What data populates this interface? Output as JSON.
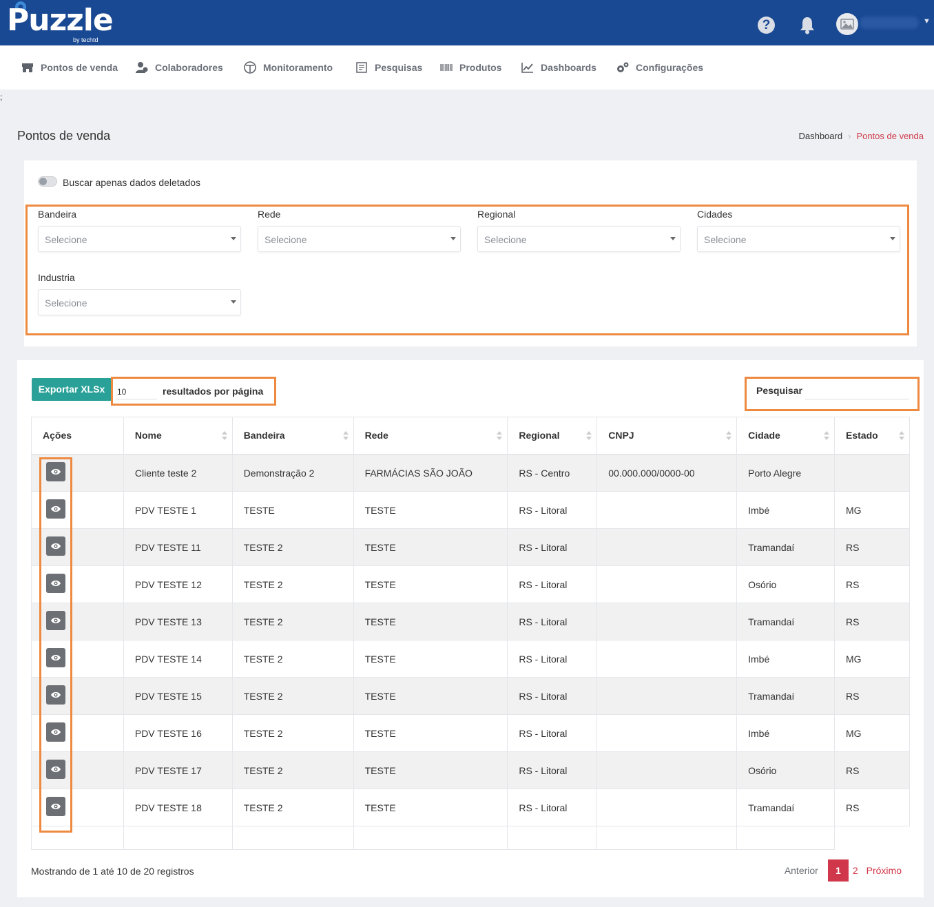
{
  "brand": {
    "name": "Puzzle",
    "sub": "by techtd"
  },
  "header": {
    "help_glyph": "?"
  },
  "nav": [
    {
      "label": "Pontos de venda",
      "icon": "store-icon"
    },
    {
      "label": "Colaboradores",
      "icon": "users-icon"
    },
    {
      "label": "Monitoramento",
      "icon": "monitor-icon"
    },
    {
      "label": "Pesquisas",
      "icon": "survey-icon"
    },
    {
      "label": "Produtos",
      "icon": "barcode-icon"
    },
    {
      "label": "Dashboards",
      "icon": "chart-icon"
    },
    {
      "label": "Configurações",
      "icon": "gears-icon"
    }
  ],
  "stray_text": ";",
  "page": {
    "title": "Pontos de venda",
    "breadcrumb": {
      "home": "Dashboard",
      "separator": "›",
      "current": "Pontos de venda"
    }
  },
  "filters": {
    "toggle_label": "Buscar apenas dados deletados",
    "fields": [
      {
        "label": "Bandeira",
        "placeholder": "Selecione"
      },
      {
        "label": "Rede",
        "placeholder": "Selecione"
      },
      {
        "label": "Regional",
        "placeholder": "Selecione"
      },
      {
        "label": "Cidades",
        "placeholder": "Selecione"
      },
      {
        "label": "Industria",
        "placeholder": "Selecione"
      }
    ]
  },
  "table_controls": {
    "export_label": "Exportar XLSx",
    "per_page_value": "10",
    "per_page_label": "resultados por página",
    "search_label": "Pesquisar",
    "search_value": ""
  },
  "table": {
    "columns": [
      "Ações",
      "Nome",
      "Bandeira",
      "Rede",
      "Regional",
      "CNPJ",
      "Cidade",
      "Estado"
    ],
    "rows": [
      {
        "nome": "Cliente teste 2",
        "bandeira": "Demonstração 2",
        "rede": "FARMÁCIAS SÃO JOÃO",
        "regional": "RS - Centro",
        "cnpj": "00.000.000/0000-00",
        "cidade": "Porto Alegre",
        "estado": ""
      },
      {
        "nome": "PDV TESTE 1",
        "bandeira": "TESTE",
        "rede": "TESTE",
        "regional": "RS - Litoral",
        "cnpj": "",
        "cidade": "Imbé",
        "estado": "MG"
      },
      {
        "nome": "PDV TESTE 11",
        "bandeira": "TESTE 2",
        "rede": "TESTE",
        "regional": "RS - Litoral",
        "cnpj": "",
        "cidade": "Tramandaí",
        "estado": "RS"
      },
      {
        "nome": "PDV TESTE 12",
        "bandeira": "TESTE 2",
        "rede": "TESTE",
        "regional": "RS - Litoral",
        "cnpj": "",
        "cidade": "Osório",
        "estado": "RS"
      },
      {
        "nome": "PDV TESTE 13",
        "bandeira": "TESTE 2",
        "rede": "TESTE",
        "regional": "RS - Litoral",
        "cnpj": "",
        "cidade": "Tramandaí",
        "estado": "RS"
      },
      {
        "nome": "PDV TESTE 14",
        "bandeira": "TESTE 2",
        "rede": "TESTE",
        "regional": "RS - Litoral",
        "cnpj": "",
        "cidade": "Imbé",
        "estado": "MG"
      },
      {
        "nome": "PDV TESTE 15",
        "bandeira": "TESTE 2",
        "rede": "TESTE",
        "regional": "RS - Litoral",
        "cnpj": "",
        "cidade": "Tramandaí",
        "estado": "RS"
      },
      {
        "nome": "PDV TESTE 16",
        "bandeira": "TESTE 2",
        "rede": "TESTE",
        "regional": "RS - Litoral",
        "cnpj": "",
        "cidade": "Imbé",
        "estado": "MG"
      },
      {
        "nome": "PDV TESTE 17",
        "bandeira": "TESTE 2",
        "rede": "TESTE",
        "regional": "RS - Litoral",
        "cnpj": "",
        "cidade": "Osório",
        "estado": "RS"
      },
      {
        "nome": "PDV TESTE 18",
        "bandeira": "TESTE 2",
        "rede": "TESTE",
        "regional": "RS - Litoral",
        "cnpj": "",
        "cidade": "Tramandaí",
        "estado": "RS"
      }
    ]
  },
  "footer": {
    "info": "Mostrando de 1 até 10 de 20 registros",
    "prev": "Anterior",
    "pages": [
      "1",
      "2"
    ],
    "next": "Próximo"
  },
  "colors": {
    "header_bg": "#1a4993",
    "accent_red": "#d0374a",
    "export_teal": "#2aa198",
    "highlight_orange": "#ee8a40"
  }
}
